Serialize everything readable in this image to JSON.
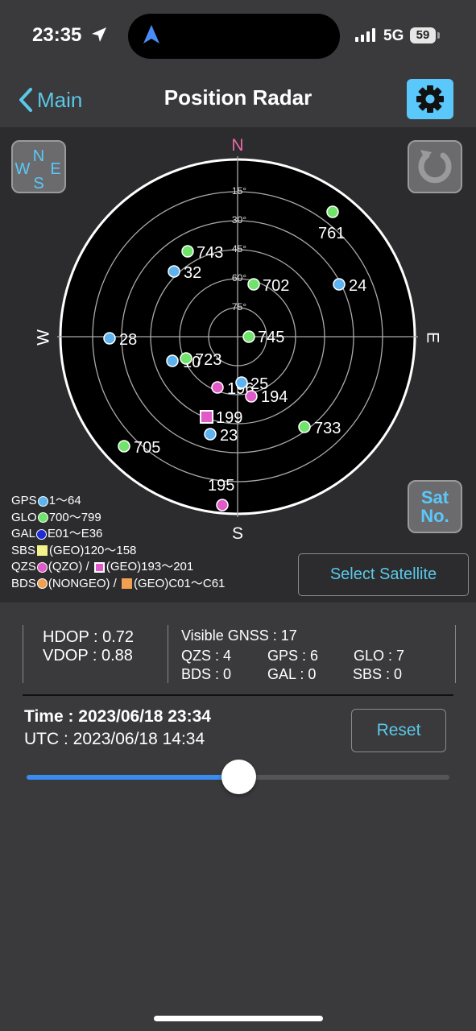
{
  "status_bar": {
    "time": "23:35",
    "network": "5G",
    "battery": "59"
  },
  "nav": {
    "back_label": "Main",
    "title": "Position Radar"
  },
  "radar": {
    "directions": {
      "n": "N",
      "e": "E",
      "s": "S",
      "w": "W"
    },
    "elevation_labels": [
      "15°",
      "30°",
      "45°",
      "60°",
      "75°"
    ],
    "satellites": [
      {
        "id": "761",
        "type": "GLO"
      },
      {
        "id": "743",
        "type": "GLO"
      },
      {
        "id": "32",
        "type": "GPS"
      },
      {
        "id": "702",
        "type": "GLO"
      },
      {
        "id": "24",
        "type": "GPS"
      },
      {
        "id": "28",
        "type": "GPS"
      },
      {
        "id": "745",
        "type": "GLO"
      },
      {
        "id": "723",
        "type": "GLO"
      },
      {
        "id": "10",
        "type": "GPS"
      },
      {
        "id": "25",
        "type": "GPS"
      },
      {
        "id": "196",
        "type": "QZS"
      },
      {
        "id": "194",
        "type": "QZS"
      },
      {
        "id": "199",
        "type": "QZS-GEO"
      },
      {
        "id": "23",
        "type": "GPS"
      },
      {
        "id": "733",
        "type": "GLO"
      },
      {
        "id": "705",
        "type": "GLO"
      },
      {
        "id": "195",
        "type": "QZS"
      }
    ],
    "colors": {
      "GPS": "#5cb3f0",
      "GLO": "#6fe36a",
      "GAL": "#1f2bd6",
      "SBS": "#f2f28a",
      "QZS": "#e05ac8",
      "BDS": "#f0a050"
    }
  },
  "compass_button": {
    "n": "N",
    "e": "E",
    "s": "S",
    "w": "W"
  },
  "satno_button": {
    "line1": "Sat",
    "line2": "No."
  },
  "legend": {
    "gps": {
      "prefix": "GPS",
      "text": "1～64"
    },
    "glo": {
      "prefix": "GLO",
      "text": "700～799"
    },
    "gal": {
      "prefix": "GAL",
      "text": "E01～E36"
    },
    "sbs": {
      "prefix": "SBS",
      "text": "(GEO)120～158"
    },
    "qzs": {
      "prefix": "QZS",
      "text1": "(QZO) / ",
      "text2": "(GEO)193～201"
    },
    "bds": {
      "prefix": "BDS",
      "text1": "(NONGEO) / ",
      "text2": "(GEO)C01～C61"
    }
  },
  "select_satellite_label": "Select Satellite",
  "dop": {
    "hdop": "HDOP : 0.72",
    "vdop": "VDOP : 0.88"
  },
  "gnss": {
    "visible": "Visible GNSS : 17",
    "qzs": "QZS : 4",
    "gps": "GPS : 6",
    "glo": "GLO : 7",
    "bds": "BDS : 0",
    "gal": "GAL : 0",
    "sbs": "SBS : 0"
  },
  "time": {
    "local": "Time : 2023/06/18 23:34",
    "utc": "UTC : 2023/06/18 14:34"
  },
  "reset_label": "Reset",
  "time_slider": {
    "value": 0.5
  }
}
